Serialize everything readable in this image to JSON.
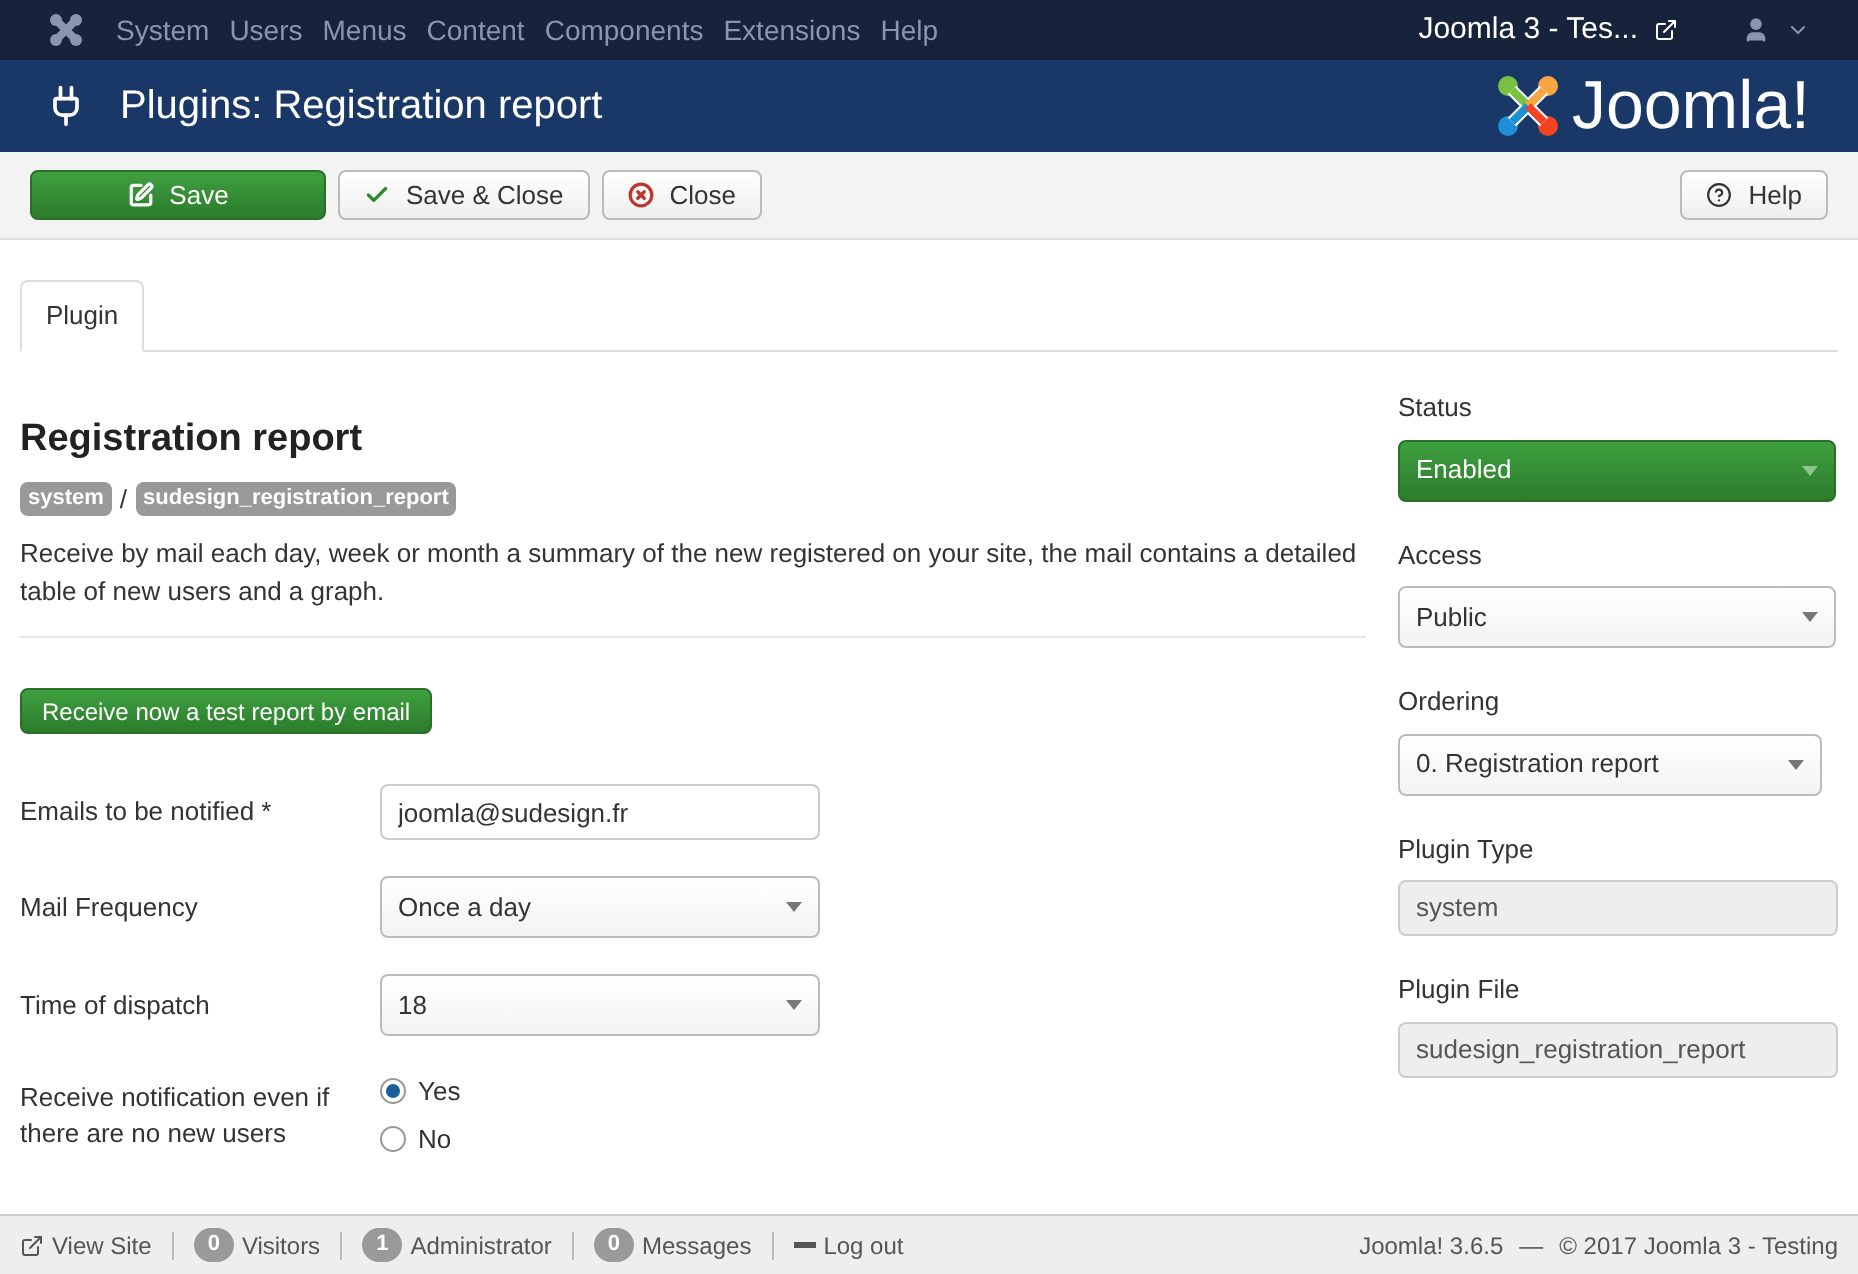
{
  "menu": {
    "items": [
      "System",
      "Users",
      "Menus",
      "Content",
      "Components",
      "Extensions",
      "Help"
    ],
    "site": "Joomla 3 - Tes..."
  },
  "header": {
    "title": "Plugins: Registration report",
    "logo": "Joomla!"
  },
  "toolbar": {
    "buttons": [
      {
        "label": "Save",
        "kind": "primary"
      },
      {
        "label": "Save & Close",
        "kind": "check"
      },
      {
        "label": "Close",
        "kind": "close"
      }
    ],
    "help": "Help"
  },
  "tabs": [
    {
      "label": "Plugin",
      "selected": true
    }
  ],
  "plugin": {
    "title": "Registration report",
    "folder": "system",
    "separator": "/",
    "element": "sudesign_registration_report",
    "description": "Receive by mail each day, week or month a summary of the new registered on your site, the mail contains a detailed table of new users and a graph.",
    "action": "Receive now a test report by email"
  },
  "fields": [
    {
      "kind": "text",
      "label": "Emails to be notified *",
      "value": "joomla@sudesign.fr"
    },
    {
      "kind": "select",
      "label": "Mail Frequency",
      "value": "Once a day"
    },
    {
      "kind": "select",
      "label": "Time of dispatch",
      "value": "18"
    },
    {
      "kind": "radio",
      "label": "Receive notification even if there are no new users",
      "options": [
        {
          "label": "Yes",
          "selected": true
        },
        {
          "label": "No",
          "selected": false
        }
      ]
    }
  ],
  "sidebar": [
    {
      "kind": "status",
      "label": "Status",
      "value": "Enabled"
    },
    {
      "kind": "select",
      "label": "Access",
      "value": "Public"
    },
    {
      "kind": "select",
      "label": "Ordering",
      "value": "0. Registration report"
    },
    {
      "kind": "readonly",
      "label": "Plugin Type",
      "value": "system"
    },
    {
      "kind": "readonly",
      "label": "Plugin File",
      "value": "sudesign_registration_report"
    }
  ],
  "footer": {
    "items": [
      {
        "kind": "link",
        "label": "View Site"
      },
      {
        "kind": "count",
        "count": "0",
        "label": "Visitors"
      },
      {
        "kind": "count",
        "count": "1",
        "label": "Administrator"
      },
      {
        "kind": "count",
        "count": "0",
        "label": "Messages"
      },
      {
        "kind": "logout",
        "label": "Log out"
      }
    ],
    "version": "Joomla! 3.6.5",
    "dash": "—",
    "copyright": "© 2017 Joomla 3 - Testing"
  }
}
